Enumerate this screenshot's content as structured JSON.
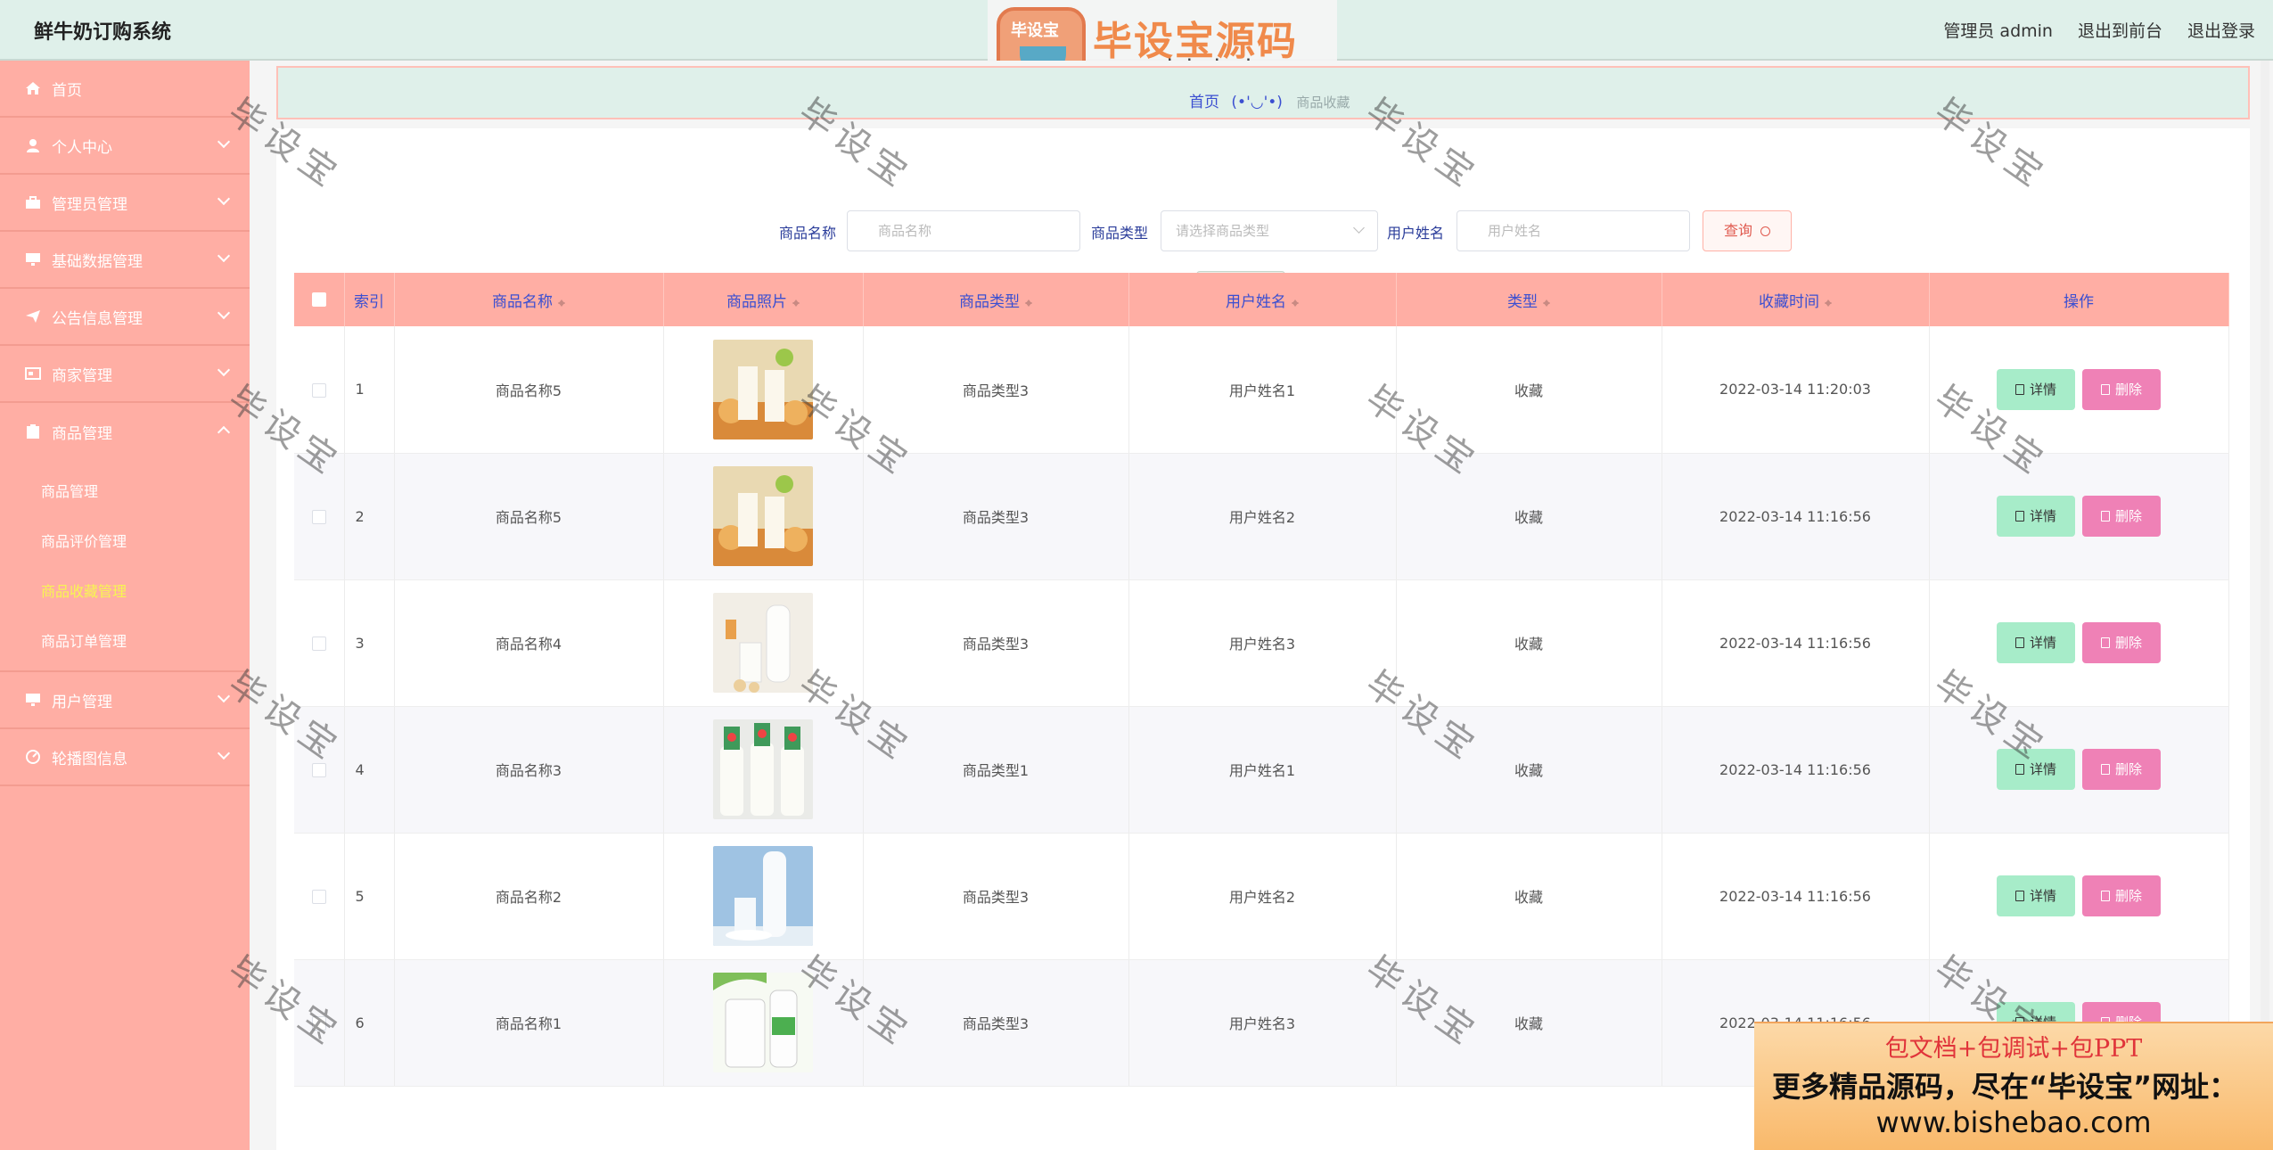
{
  "app": {
    "title": "鲜牛奶订购系统"
  },
  "topnav": {
    "user": "管理员 admin",
    "front": "退出到前台",
    "logout": "退出登录"
  },
  "logo": {
    "badge": "毕设宝",
    "title": "毕设宝源码网",
    "url": "www.bishebao.com"
  },
  "sidebar": {
    "items": [
      {
        "label": "首页",
        "icon": "home-icon"
      },
      {
        "label": "个人中心",
        "icon": "person-icon"
      },
      {
        "label": "管理员管理",
        "icon": "briefcase-icon"
      },
      {
        "label": "基础数据管理",
        "icon": "monitor-icon"
      },
      {
        "label": "公告信息管理",
        "icon": "send-icon"
      },
      {
        "label": "商家管理",
        "icon": "id-card-icon"
      },
      {
        "label": "商品管理",
        "icon": "clipboard-icon"
      },
      {
        "label": "用户管理",
        "icon": "monitor-icon"
      },
      {
        "label": "轮播图信息",
        "icon": "dashboard-icon"
      }
    ],
    "submenu": [
      "商品管理",
      "商品评价管理",
      "商品收藏管理",
      "商品订单管理"
    ],
    "active_submenu": "商品收藏管理"
  },
  "breadcrumb": {
    "home": "首页",
    "emoticon": "(•'◡'•)",
    "current": "商品收藏"
  },
  "search": {
    "name_label": "商品名称",
    "name_placeholder": "商品名称",
    "type_label": "商品类型",
    "type_placeholder": "请选择商品类型",
    "user_label": "用户姓名",
    "user_placeholder": "用户姓名",
    "query_button": "查询",
    "delete_button": "删除"
  },
  "table": {
    "headers": [
      "索引",
      "商品名称",
      "商品照片",
      "商品类型",
      "用户姓名",
      "类型",
      "收藏时间",
      "操作"
    ],
    "detail_label": "详情",
    "delete_label": "删除",
    "rows": [
      {
        "index": "1",
        "name": "商品名称5",
        "type": "商品类型3",
        "user": "用户姓名1",
        "kind": "收藏",
        "time": "2022-03-14 11:20:03",
        "photo": "milk-with-bread"
      },
      {
        "index": "2",
        "name": "商品名称5",
        "type": "商品类型3",
        "user": "用户姓名2",
        "kind": "收藏",
        "time": "2022-03-14 11:16:56",
        "photo": "milk-with-bread"
      },
      {
        "index": "3",
        "name": "商品名称4",
        "type": "商品类型3",
        "user": "用户姓名3",
        "kind": "收藏",
        "time": "2022-03-14 11:16:56",
        "photo": "milk-bottle-glass"
      },
      {
        "index": "4",
        "name": "商品名称3",
        "type": "商品类型1",
        "user": "用户姓名1",
        "kind": "收藏",
        "time": "2022-03-14 11:16:56",
        "photo": "milk-bottles-green"
      },
      {
        "index": "5",
        "name": "商品名称2",
        "type": "商品类型3",
        "user": "用户姓名2",
        "kind": "收藏",
        "time": "2022-03-14 11:16:56",
        "photo": "milk-blue-sky"
      },
      {
        "index": "6",
        "name": "商品名称1",
        "type": "商品类型3",
        "user": "用户姓名3",
        "kind": "收藏",
        "time": "2022-03-14 11:16:56",
        "photo": "milk-jug"
      }
    ]
  },
  "watermark": "毕设宝",
  "promo": {
    "line1": "包文档+包调试+包PPT",
    "line2": "更多精品源码，尽在“毕设宝”网址：",
    "line3": "www.bishebao.com"
  },
  "colors": {
    "sidebar": "#ffaea4",
    "header": "#dff0ea",
    "active": "#f7f750",
    "detail": "#a7ecc9",
    "delete": "#ef81b6"
  }
}
